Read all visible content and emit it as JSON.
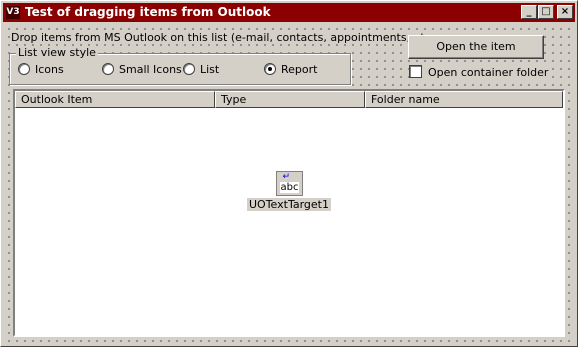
{
  "window": {
    "title": "Test of dragging items from Outlook",
    "icon_text": "V3",
    "controls": {
      "minimize": "_",
      "maximize": "□",
      "close": "×"
    }
  },
  "instructions": "Drop items from MS Outlook on this list (e-mail, contacts, appointments, etc",
  "list_view_style": {
    "legend": "List view style",
    "options": [
      {
        "label": "Icons",
        "selected": false
      },
      {
        "label": "Small Icons",
        "selected": false
      },
      {
        "label": "List",
        "selected": false
      },
      {
        "label": "Report",
        "selected": true
      }
    ]
  },
  "open_button": "Open the item",
  "open_container": {
    "label": "Open container folder",
    "checked": false
  },
  "list": {
    "columns": [
      "Outlook Item",
      "Type",
      "Folder name"
    ]
  },
  "design_component": {
    "glyph": "abc",
    "label": "UOTextTarget1"
  },
  "colors": {
    "title_bar": "#8b0000",
    "face": "#d4d0c8"
  }
}
